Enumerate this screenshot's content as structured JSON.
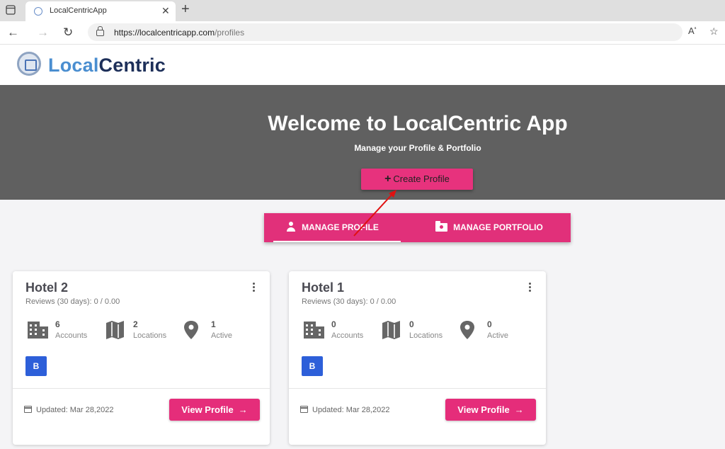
{
  "browser": {
    "tab_title": "LocalCentricApp",
    "url_host": "https://localcentricapp.com",
    "url_path": "/profiles"
  },
  "brand": {
    "part1": "Local",
    "part2": "Centric"
  },
  "hero": {
    "title": "Welcome to LocalCentric App",
    "subtitle": "Manage your Profile & Portfolio",
    "create_button": "Create Profile"
  },
  "tabs": [
    {
      "label": "MANAGE PROFILE",
      "icon": "person-icon",
      "active": true
    },
    {
      "label": "MANAGE PORTFOLIO",
      "icon": "folder-icon",
      "active": false
    }
  ],
  "cards": [
    {
      "title": "Hotel 2",
      "reviews": "Reviews (30 days): 0 / 0.00",
      "stats": [
        {
          "value": "6",
          "label": "Accounts",
          "icon": "building-icon"
        },
        {
          "value": "2",
          "label": "Locations",
          "icon": "map-icon"
        },
        {
          "value": "1",
          "label": "Active",
          "icon": "pin-icon"
        }
      ],
      "badge": "B",
      "updated": "Updated: Mar 28,2022",
      "view_button": "View Profile"
    },
    {
      "title": "Hotel 1",
      "reviews": "Reviews (30 days): 0 / 0.00",
      "stats": [
        {
          "value": "0",
          "label": "Accounts",
          "icon": "building-icon"
        },
        {
          "value": "0",
          "label": "Locations",
          "icon": "map-icon"
        },
        {
          "value": "0",
          "label": "Active",
          "icon": "pin-icon"
        }
      ],
      "badge": "B",
      "updated": "Updated: Mar 28,2022",
      "view_button": "View Profile"
    }
  ],
  "colors": {
    "accent": "#e52d7a",
    "hero_bg": "#606060",
    "brand_light": "#4a8ed0",
    "brand_dark": "#1d2f59",
    "badge": "#2d5fd9"
  }
}
